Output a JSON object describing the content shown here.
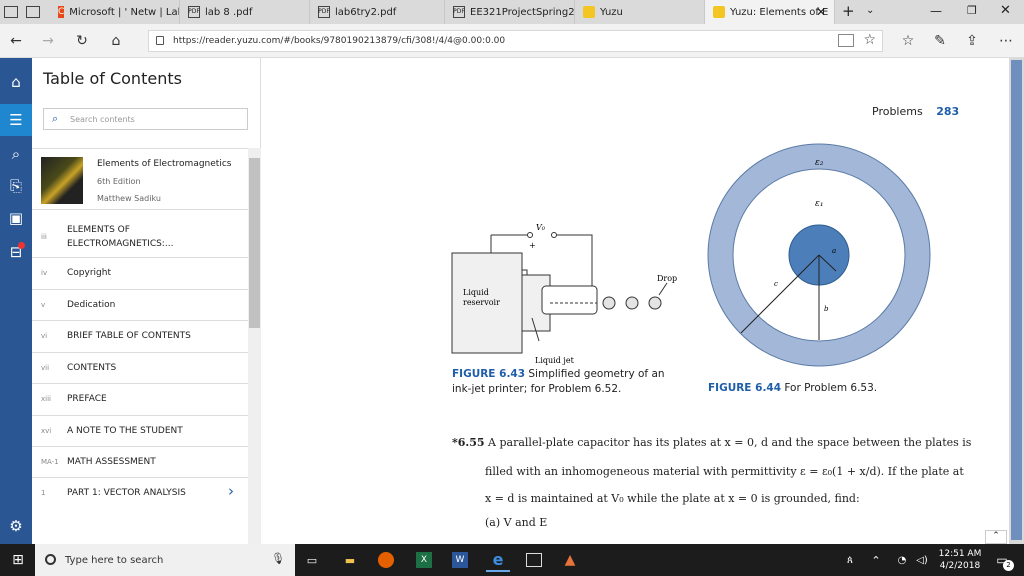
{
  "tabs": [
    {
      "label": "Microsoft | ' Netw | Lab"
    },
    {
      "label": "lab 8 .pdf"
    },
    {
      "label": "lab6try2.pdf"
    },
    {
      "label": "EE321ProjectSpring201"
    },
    {
      "label": "Yuzu"
    },
    {
      "label": "Yuzu: Elements of E"
    }
  ],
  "address": {
    "url": "https://reader.yuzu.com/#/books/9780190213879/cfi/308!/4/4@0.00:0.00"
  },
  "toc": {
    "title": "Table of Contents",
    "search_placeholder": "Search contents",
    "book": {
      "title": "Elements of Electromagnetics",
      "edition": "6th Edition",
      "author": "Matthew Sadiku"
    },
    "items": [
      {
        "page": "iii",
        "label": "ELEMENTS OF ELECTROMAGNETICS:..."
      },
      {
        "page": "iv",
        "label": "Copyright"
      },
      {
        "page": "v",
        "label": "Dedication"
      },
      {
        "page": "vi",
        "label": "BRIEF TABLE OF CONTENTS"
      },
      {
        "page": "vii",
        "label": "CONTENTS"
      },
      {
        "page": "xiii",
        "label": "PREFACE"
      },
      {
        "page": "xvi",
        "label": "A NOTE TO THE STUDENT"
      },
      {
        "page": "MA-1",
        "label": "MATH ASSESSMENT"
      },
      {
        "page": "1",
        "label": "PART 1: VECTOR ANALYSIS"
      }
    ]
  },
  "page": {
    "header_label": "Problems",
    "page_number": "283",
    "fig1": {
      "caption_num": "FIGURE 6.43",
      "caption_text": "Simplified geometry of an ink-jet printer; for Problem 6.52.",
      "vo": "V₀",
      "plus": "+",
      "drop": "Drop",
      "reservoir1": "Liquid",
      "reservoir2": "reservoir",
      "jet": "Liquid jet"
    },
    "fig2": {
      "caption_num": "FIGURE 6.44",
      "caption_text": "For Problem 6.53.",
      "eps2": "ε₂",
      "eps1": "ε₁",
      "a": "a",
      "b": "b",
      "c": "c"
    },
    "problem": {
      "number": "*6.55",
      "line1": "A parallel-plate capacitor has its plates at x = 0, d and the space between the plates is",
      "line2a": "filled with an inhomogeneous material with permittivity ε = ε₀(1 + x/d). If the plate at",
      "line3": "x = d is maintained at V₀ while the plate at x = 0 is grounded, find:",
      "part_a": "(a)  V and E"
    }
  },
  "taskbar": {
    "search_placeholder": "Type here to search",
    "time": "12:51 AM",
    "date": "4/2/2018",
    "notif_count": "2"
  },
  "colors": {
    "rail": "#2a5793",
    "accent": "#1f5ea8",
    "ring": "#a3b8d8",
    "core": "#4c7fb9"
  }
}
